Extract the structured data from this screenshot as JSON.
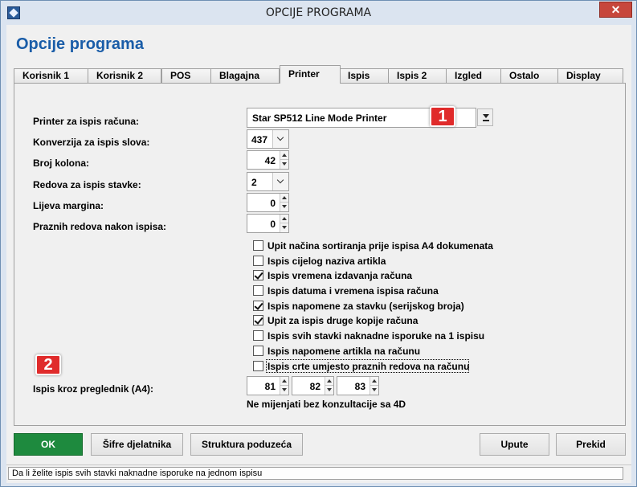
{
  "window": {
    "title": "OPCIJE PROGRAMA",
    "close_glyph": "✕"
  },
  "heading": "Opcije programa",
  "tabs": [
    {
      "label": "Korisnik 1"
    },
    {
      "label": "Korisnik 2"
    },
    {
      "label": "POS"
    },
    {
      "label": "Blagajna"
    },
    {
      "label": "Printer",
      "active": true
    },
    {
      "label": "Ispis"
    },
    {
      "label": "Ispis 2"
    },
    {
      "label": "Izgled"
    },
    {
      "label": "Ostalo"
    },
    {
      "label": "Display"
    }
  ],
  "fields": {
    "printer_label": "Printer za ispis računa:",
    "printer_value": "Star SP512 Line Mode Printer",
    "conversion_label": "Konverzija za ispis slova:",
    "conversion_value": "437",
    "columns_label": "Broj kolona:",
    "columns_value": "42",
    "rows_label": "Redova za ispis stavke:",
    "rows_value": "2",
    "margin_label": "Lijeva margina:",
    "margin_value": "0",
    "empty_rows_label": "Praznih redova nakon ispisa:",
    "empty_rows_value": "0",
    "browser_label": "Ispis kroz preglednik (A4):",
    "browser_values": [
      "81",
      "82",
      "83"
    ],
    "note": "Ne mijenjati bez konzultacije sa 4D"
  },
  "checkboxes": [
    {
      "label": "Upit načina sortiranja prije ispisa A4 dokumenata",
      "checked": false
    },
    {
      "label": "Ispis cijelog naziva artikla",
      "checked": false
    },
    {
      "label": "Ispis vremena izdavanja računa",
      "checked": true
    },
    {
      "label": "Ispis datuma i vremena ispisa računa",
      "checked": false
    },
    {
      "label": "Ispis napomene za stavku (serijskog broja)",
      "checked": true
    },
    {
      "label": "Upit za ispis druge kopije računa",
      "checked": true
    },
    {
      "label": "Ispis svih stavki naknadne isporuke na 1 ispisu",
      "checked": false
    },
    {
      "label": "Ispis napomene artikla na računu",
      "checked": false
    },
    {
      "label": "Ispis crte umjesto praznih redova na računu",
      "checked": false
    }
  ],
  "markers": {
    "one": "1",
    "two": "2"
  },
  "buttons": {
    "ok": "OK",
    "employee_codes": "Šifre djelatnika",
    "company_structure": "Struktura poduzeća",
    "instructions": "Upute",
    "cancel": "Prekid"
  },
  "status": "Da li želite ispis svih stavki naknadne isporuke na jednom ispisu",
  "colors": {
    "heading": "#1a5da8",
    "ok_button": "#1e8a3e",
    "marker": "#e02b2b",
    "close_button": "#c7473c"
  }
}
